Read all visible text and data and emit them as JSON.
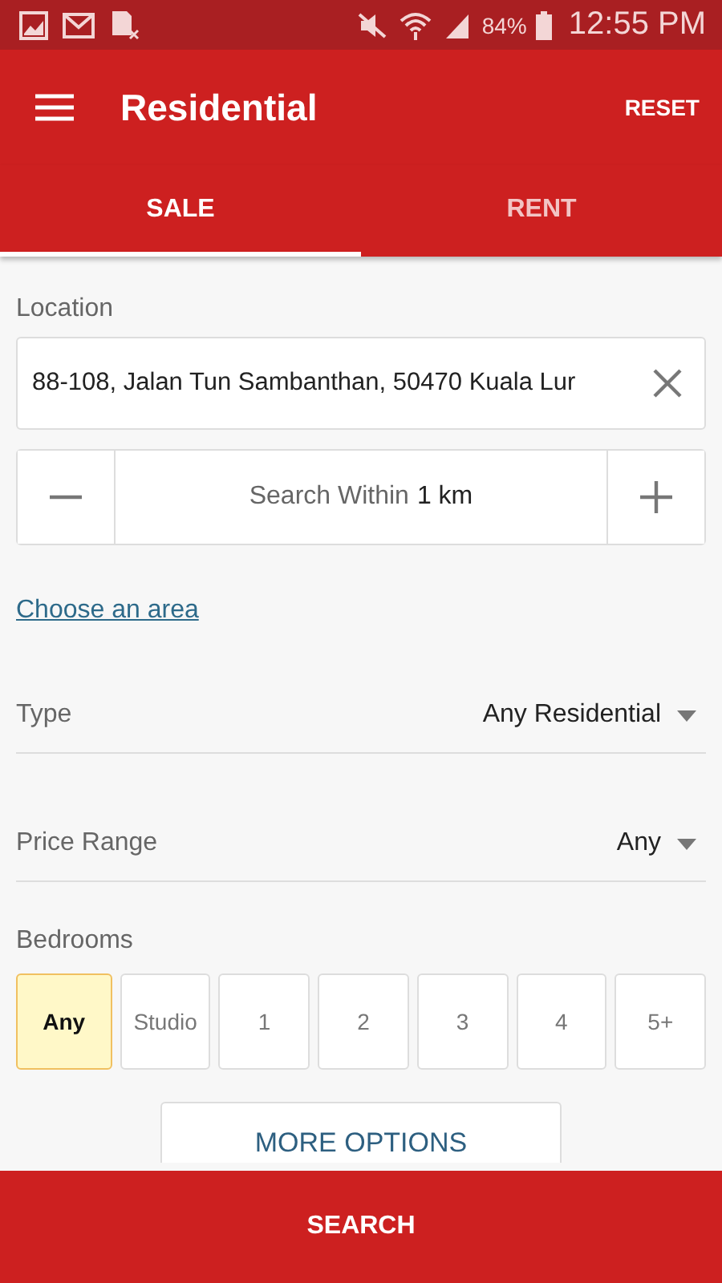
{
  "status_bar": {
    "battery": "84%",
    "time": "12:55 PM"
  },
  "app_bar": {
    "title": "Residential",
    "action": "RESET"
  },
  "tabs": [
    {
      "label": "SALE",
      "selected": true
    },
    {
      "label": "RENT",
      "selected": false
    }
  ],
  "location": {
    "label": "Location",
    "value": "88-108, Jalan Tun Sambanthan, 50470 Kuala Lur"
  },
  "radius": {
    "label": "Search Within",
    "value": "1 km"
  },
  "area_link": "Choose an area",
  "filters": [
    {
      "label": "Type",
      "value": "Any Residential"
    },
    {
      "label": "Price Range",
      "value": "Any"
    }
  ],
  "bedrooms": {
    "label": "Bedrooms",
    "options": [
      {
        "label": "Any",
        "selected": true
      },
      {
        "label": "Studio",
        "selected": false
      },
      {
        "label": "1",
        "selected": false
      },
      {
        "label": "2",
        "selected": false
      },
      {
        "label": "3",
        "selected": false
      },
      {
        "label": "4",
        "selected": false
      },
      {
        "label": "5+",
        "selected": false
      }
    ]
  },
  "more_button": "MORE OPTIONS",
  "search_button": "SEARCH"
}
